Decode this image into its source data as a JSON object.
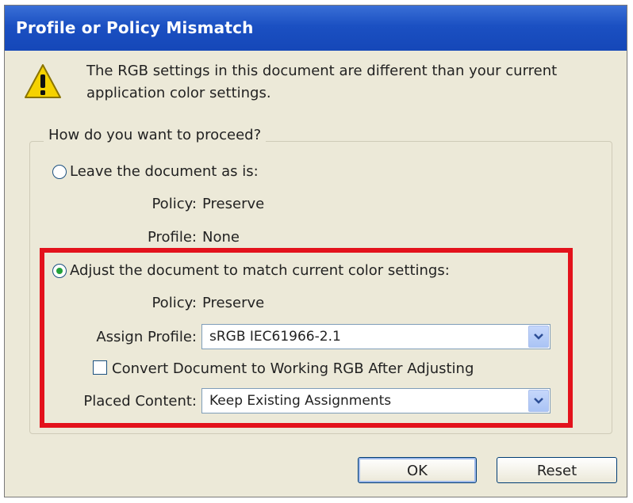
{
  "dialog": {
    "title": "Profile or Policy Mismatch",
    "message": "The RGB settings in this document are different than your current application color settings.",
    "icon": "warning-icon"
  },
  "group": {
    "legend": "How do you want to proceed?"
  },
  "option_leave": {
    "label": "Leave the document as is:",
    "selected": false,
    "policy_label": "Policy:",
    "policy_value": "Preserve",
    "profile_label": "Profile:",
    "profile_value": "None"
  },
  "option_adjust": {
    "label": "Adjust the document to match current color settings:",
    "selected": true,
    "policy_label": "Policy:",
    "policy_value": "Preserve",
    "assign_profile_label": "Assign Profile:",
    "assign_profile_value": "sRGB IEC61966-2.1",
    "convert_label": "Convert Document to Working RGB After Adjusting",
    "convert_checked": false,
    "placed_content_label": "Placed Content:",
    "placed_content_value": "Keep Existing Assignments"
  },
  "buttons": {
    "ok": "OK",
    "reset": "Reset"
  },
  "colors": {
    "titlebar": "#1b50c2",
    "dialog_bg": "#ece9d8",
    "highlight": "#e3121c",
    "radio_dot": "#22a13a"
  }
}
